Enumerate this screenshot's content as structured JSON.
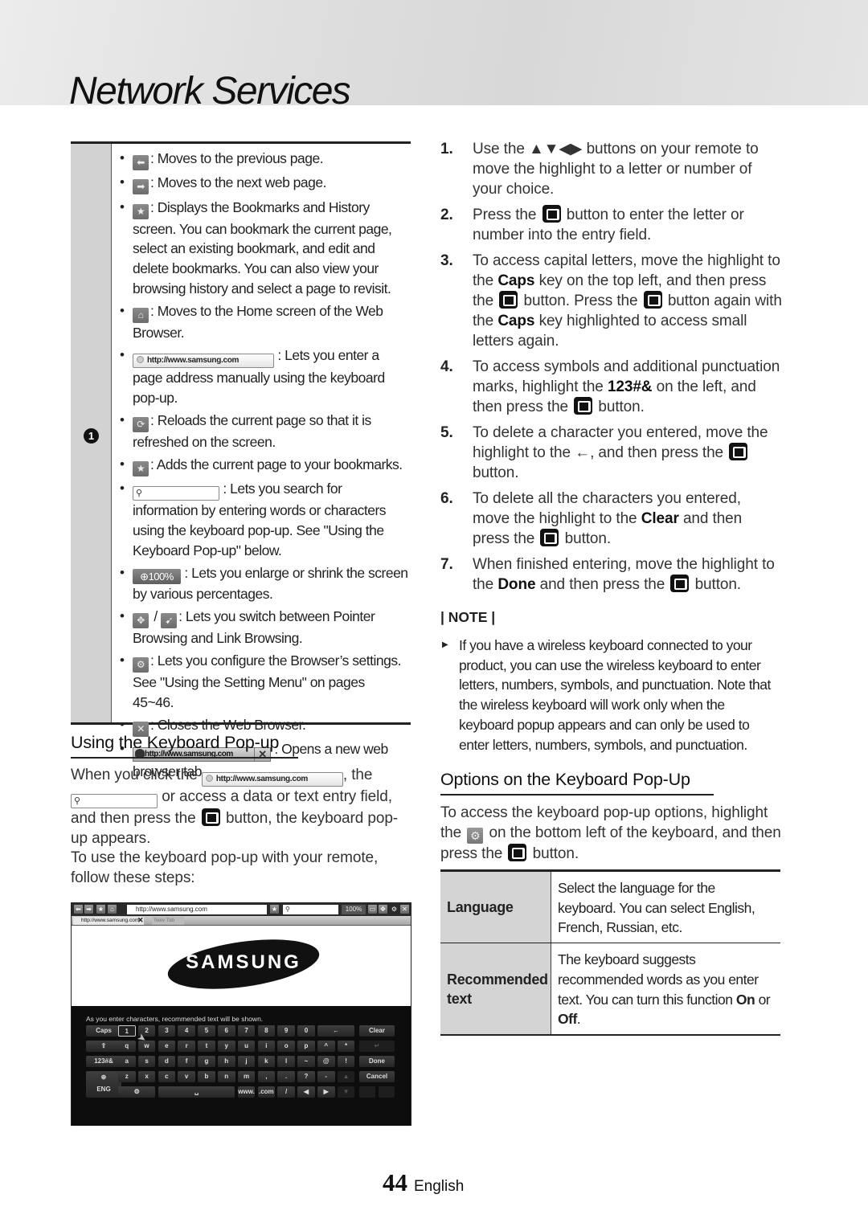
{
  "header": {
    "title": "Network Services"
  },
  "browser_table": {
    "callout_number": "1",
    "items": [
      {
        "icon": "back-arrow-icon",
        "text": ": Moves to the previous page."
      },
      {
        "icon": "forward-arrow-icon",
        "text": ": Moves to the next web page."
      },
      {
        "icon": "bookmarks-star-icon",
        "text": ": Displays the Bookmarks and History screen. You can bookmark the current page, select an existing bookmark, and edit and delete bookmarks. You can also view your browsing history and select a page to revisit."
      },
      {
        "icon": "home-icon",
        "text": ": Moves to the Home screen of the Web Browser."
      },
      {
        "icon": "address-bar",
        "url": "http://www.samsung.com",
        "text": ": Lets you enter a page address manually using the keyboard pop-up."
      },
      {
        "icon": "reload-icon",
        "text": ": Reloads the current page so that it is refreshed on the screen."
      },
      {
        "icon": "add-bookmark-icon",
        "text": ": Adds the current page to your bookmarks."
      },
      {
        "icon": "search-field",
        "text": ": Lets you search for information by entering words or characters using the keyboard pop-up. See \"Using the Keyboard Pop-up\" below."
      },
      {
        "icon": "zoom-button",
        "zoom": "100%",
        "text": ": Lets you enlarge or shrink the screen by various percentages."
      },
      {
        "icon": "pointer-link-toggle",
        "separator": "/",
        "text": ": Lets you switch between Pointer Browsing and Link Browsing."
      },
      {
        "icon": "settings-gear-icon",
        "text": ": Lets you configure the Browser’s settings. See \"Using the Setting Menu\" on pages 45~46."
      },
      {
        "icon": "close-x-icon",
        "text": ": Closes the Web Browser."
      },
      {
        "icon": "browser-tab",
        "url": "http://www.samsung.com",
        "text": ": Opens a new web browser tab."
      }
    ]
  },
  "keyboard_section": {
    "heading": "Using the Keyboard Pop-up",
    "para1": {
      "a": "When you click the",
      "url": "http://www.samsung.com",
      "b": ", the",
      "c": "or access a data or text entry field, and then press the",
      "d": "button, the keyboard pop-up appears."
    },
    "para2": "To use the keyboard pop-up with your remote, follow these steps:"
  },
  "screenshot": {
    "url": "http://www.samsung.com",
    "zoom": "100%",
    "tab1": "http://www.samsung.com",
    "tab2": "New Tab",
    "logo": "SAMSUNG",
    "message": "As you enter characters, recommended text will be shown.",
    "keys": {
      "row1": [
        "Caps",
        "1",
        "2",
        "3",
        "4",
        "5",
        "6",
        "7",
        "8",
        "9",
        "0",
        "←",
        "Clear"
      ],
      "row2": [
        "⇧",
        "q",
        "w",
        "e",
        "r",
        "t",
        "y",
        "u",
        "i",
        "o",
        "p",
        "^",
        "*",
        "↵"
      ],
      "row3": [
        "123#&",
        "a",
        "s",
        "d",
        "f",
        "g",
        "h",
        "j",
        "k",
        "l",
        "~",
        "@",
        "!",
        "Done"
      ],
      "row4": [
        "z",
        "x",
        "c",
        "v",
        "b",
        "n",
        "m",
        ",",
        ".",
        "?",
        "-",
        "▲",
        "Cancel"
      ],
      "row5": [
        "⚙",
        "␣",
        "www.",
        ".com",
        "/",
        "◀",
        "▶",
        "▼"
      ],
      "lang": "ENG",
      "globe": "🌐"
    }
  },
  "steps": [
    {
      "n": "1.",
      "parts": [
        "Use the ▲▼◀▶ buttons on your remote to move the highlight to a letter or number of your choice."
      ]
    },
    {
      "n": "2.",
      "a": "Press the",
      "b": "button to enter the letter or number into the entry field."
    },
    {
      "n": "3.",
      "a": "To access capital letters, move the highlight to the",
      "k1": "Caps",
      "b": "key on the top left, and then press the",
      "c": "button. Press the",
      "d": "button again with the",
      "k2": "Caps",
      "e": "key highlighted to access small letters again."
    },
    {
      "n": "4.",
      "a": "To access symbols and additional punctuation marks, highlight the",
      "k1": "123#&",
      "b": "on the left, and then press the",
      "c": "button."
    },
    {
      "n": "5.",
      "a": "To delete a character you entered, move the highlight to the ←, and then press the",
      "b": "button."
    },
    {
      "n": "6.",
      "a": "To delete all the characters you entered, move the highlight to the",
      "k1": "Clear",
      "b": "and then press the",
      "c": "button."
    },
    {
      "n": "7.",
      "a": "When finished entering, move the highlight to the",
      "k1": "Done",
      "b": "and then press the",
      "c": "button."
    }
  ],
  "note": {
    "heading": "| NOTE |",
    "text": "If you have a wireless keyboard connected to your product, you can use the wireless keyboard to enter letters, numbers, symbols, and punctuation. Note that the wireless keyboard will work only when the keyboard popup appears and can only be used to enter letters, numbers, symbols, and punctuation."
  },
  "options_section": {
    "heading": "Options on the Keyboard Pop-Up",
    "para": {
      "a": "To access the keyboard pop-up options, highlight the",
      "b": "on the bottom left of the keyboard, and then press the",
      "c": "button."
    },
    "rows": [
      {
        "key": "Language",
        "value": "Select the language for the keyboard. You can select English, French, Russian, etc."
      },
      {
        "key": "Recommended text",
        "value_a": "The keyboard suggests recommended words as you enter text. You can turn this function",
        "on": "On",
        "or": "or",
        "off": "Off",
        "end": "."
      }
    ]
  },
  "footer": {
    "page": "44",
    "lang": "English"
  }
}
